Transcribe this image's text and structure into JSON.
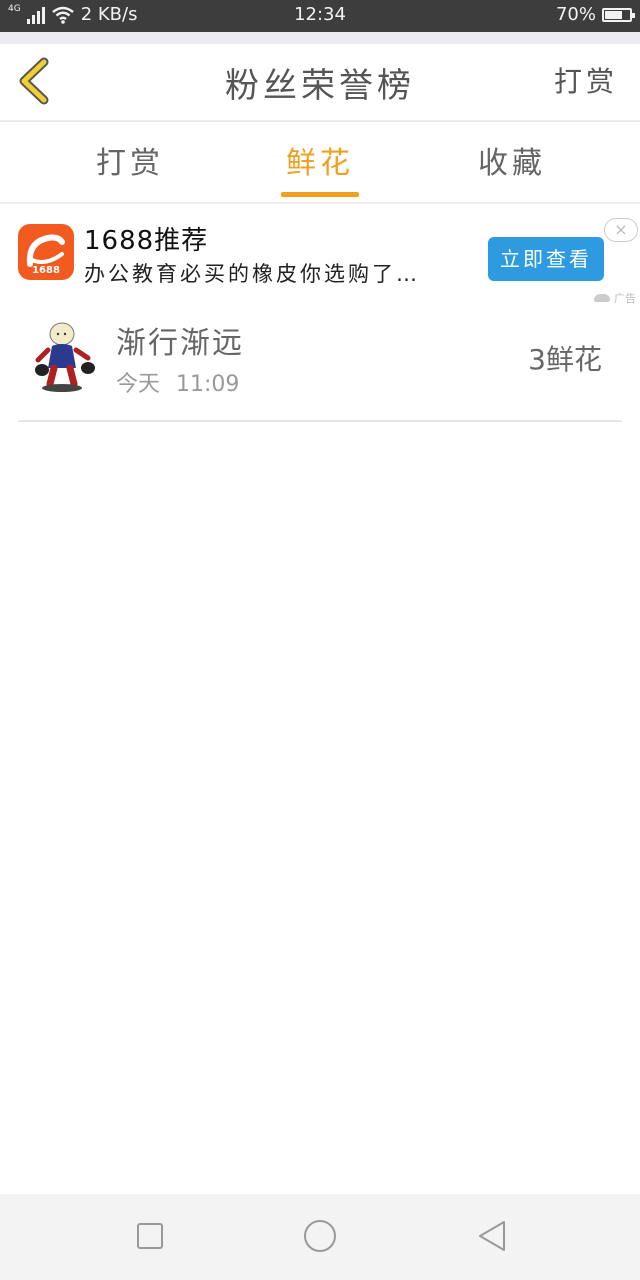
{
  "status_bar": {
    "network": "4G",
    "speed": "2  KB/s",
    "time": "12:34",
    "battery": "70%",
    "battery_level": 0.7
  },
  "header": {
    "title": "粉丝荣誉榜",
    "action": "打赏",
    "icons": {
      "back": "chevron-left-icon"
    },
    "accent_color": "#f0d030"
  },
  "tabs": [
    {
      "label": "打赏",
      "active": false
    },
    {
      "label": "鲜花",
      "active": true
    },
    {
      "label": "收藏",
      "active": false
    }
  ],
  "colors": {
    "active_tab": "#f0a020",
    "ad_button": "#2e9be0",
    "ad_logo": "#f25a1f"
  },
  "ad": {
    "logo_text": "1688",
    "title": "1688推荐",
    "description": "办公教育必买的橡皮你选购了…",
    "button": "立即查看",
    "close": "×",
    "badge": "广告"
  },
  "list": [
    {
      "name": "渐行渐远",
      "date": "今天",
      "time": "11:09",
      "value": "3鲜花"
    }
  ],
  "nav_bar": {
    "icons": [
      "square-icon",
      "circle-home-icon",
      "triangle-back-icon"
    ]
  }
}
